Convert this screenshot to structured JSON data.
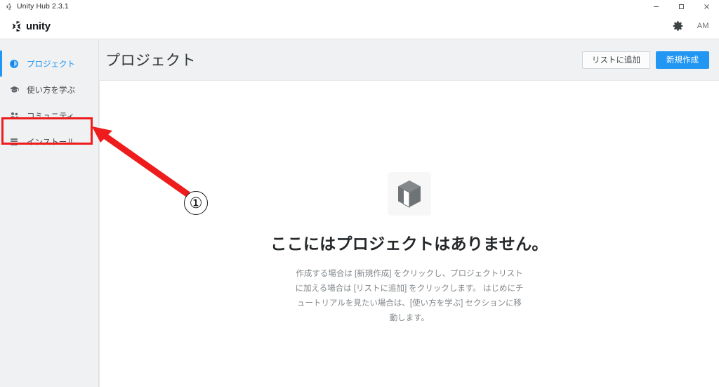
{
  "window": {
    "title": "Unity Hub 2.3.1",
    "app_icon": "unity-cube-icon",
    "controls": {
      "minimize": "–",
      "maximize": "☐",
      "close": "✕"
    }
  },
  "brand": {
    "logo_icon": "unity-logo-icon",
    "wordmark": "unity",
    "settings_icon": "gear-icon",
    "account_initials": "AM"
  },
  "sidebar": {
    "items": [
      {
        "label": "プロジェクト",
        "icon": "projects-cube-icon",
        "active": true
      },
      {
        "label": "使い方を学ぶ",
        "icon": "graduation-cap-icon",
        "active": false
      },
      {
        "label": "コミュニティ",
        "icon": "people-icon",
        "active": false
      },
      {
        "label": "インストール",
        "icon": "list-icon",
        "active": false
      }
    ]
  },
  "main": {
    "page_title": "プロジェクト",
    "add_to_list_label": "リストに追加",
    "new_project_label": "新規作成",
    "empty_state": {
      "icon": "cube-3d-icon",
      "title": "ここにはプロジェクトはありません。",
      "description": "作成する場合は [新規作成] をクリックし、プロジェクトリストに加える場合は [リストに追加] をクリックします。 はじめにチュートリアルを見たい場合は、[使い方を学ぶ] セクションに移動します。"
    }
  },
  "annotations": {
    "step_number": "①",
    "highlight_color": "#ee1c1c",
    "arrow_color": "#ee1c1c",
    "highlight_target": "インストール"
  },
  "colors": {
    "accent": "#2196f3",
    "sidebar_bg": "#f0f1f2",
    "panel_bg": "#ffffff",
    "text": "#41464a",
    "muted_text": "#81868a"
  }
}
